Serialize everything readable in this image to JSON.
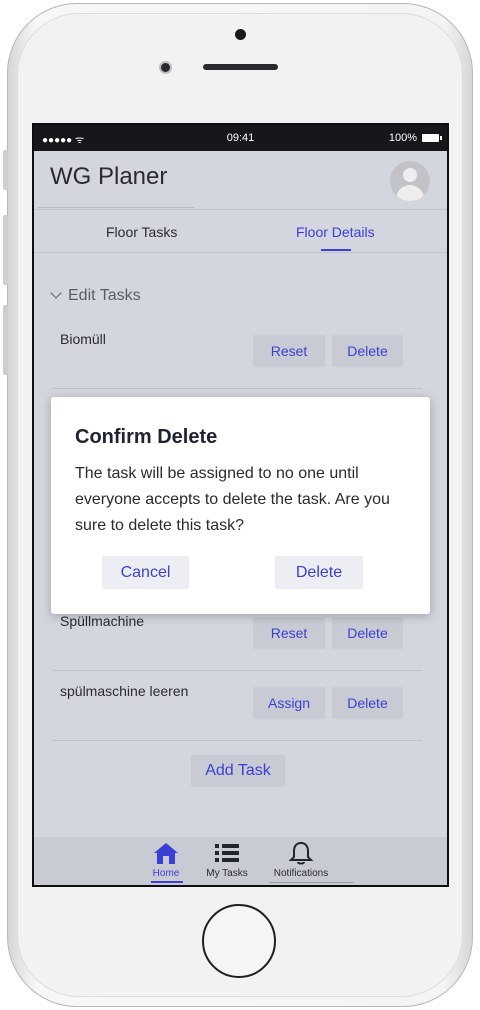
{
  "status_bar": {
    "signal": "●●●●● ᯤ",
    "time": "09:41",
    "battery": "100%"
  },
  "header": {
    "title": "WG Planer"
  },
  "tabs": [
    {
      "label": "Floor Tasks"
    },
    {
      "label": "Floor Details"
    }
  ],
  "section": {
    "label": "Edit Tasks"
  },
  "tasks": [
    {
      "name": "Biomüll",
      "primary": "Reset",
      "delete": "Delete"
    },
    {
      "name": "Spüllmachine",
      "primary": "Reset",
      "delete": "Delete"
    },
    {
      "name": "spülmaschine leeren",
      "primary": "Assign",
      "delete": "Delete"
    }
  ],
  "add_task": "Add Task",
  "bottom_nav": [
    {
      "label": "Home",
      "icon": "home-icon"
    },
    {
      "label": "My Tasks",
      "icon": "list-icon"
    },
    {
      "label": "Notifications",
      "icon": "bell-icon"
    }
  ],
  "dialog": {
    "title": "Confirm Delete",
    "body": "The task will be assigned to no one until everyone accepts to delete the task. Are you sure to delete this task?",
    "cancel": "Cancel",
    "confirm": "Delete"
  },
  "colors": {
    "accent": "#3b3fd3",
    "screen_bg": "#d4d6df",
    "button_bg": "#c8cad4"
  }
}
